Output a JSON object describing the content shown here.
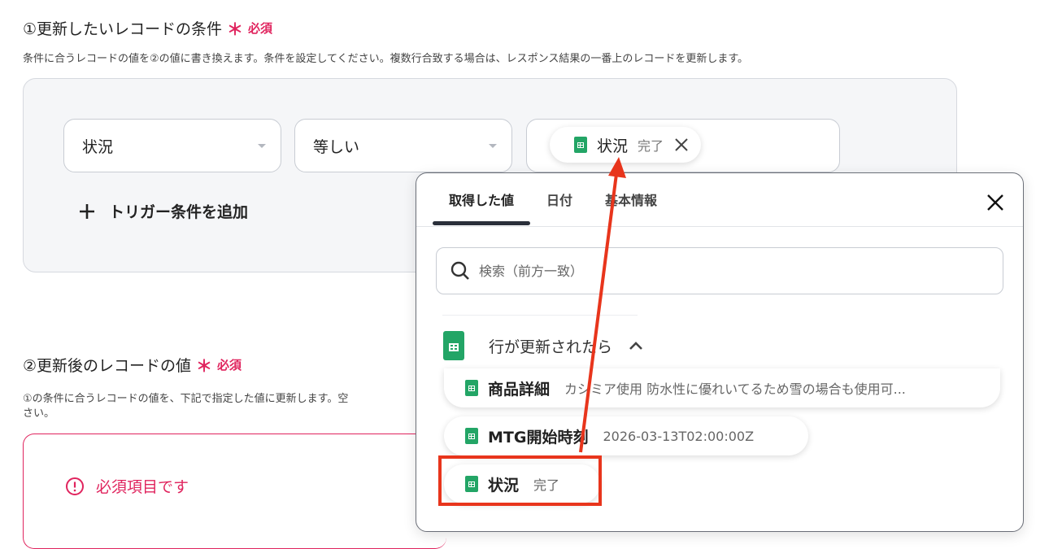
{
  "section1": {
    "title": "①更新したいレコードの条件",
    "required_star": "＊",
    "required_label": "必須",
    "description": "条件に合うレコードの値を②の値に書き換えます。条件を設定してください。複数行合致する場合は、レスポンス結果の一番上のレコードを更新します。",
    "field_select": "状況",
    "operator_select": "等しい",
    "value_chip": {
      "name": "状況",
      "value": "完了"
    },
    "add_condition": "トリガー条件を追加"
  },
  "section2": {
    "title": "②更新後のレコードの値",
    "required_star": "＊",
    "required_label": "必須",
    "description_line1": "①の条件に合うレコードの値を、下記で指定した値に更新します。空",
    "description_line2": "さい。",
    "error_text": "必須項目です"
  },
  "panel": {
    "tabs": [
      "取得した値",
      "日付",
      "基本情報"
    ],
    "active_tab": 0,
    "search_placeholder": "検索（前方一致）",
    "group_label": "行が更新されたら",
    "items": [
      {
        "name": "商品詳細",
        "value": "カシミア使用 防水性に優れいてるため雪の場合も使用可..."
      },
      {
        "name": "MTG開始時刻",
        "value": "2026-03-13T02:00:00Z"
      },
      {
        "name": "状況",
        "value": "完了"
      }
    ]
  },
  "colors": {
    "required": "#e0245e",
    "sheets_green": "#23a566",
    "annotation_red": "#e8351c"
  }
}
